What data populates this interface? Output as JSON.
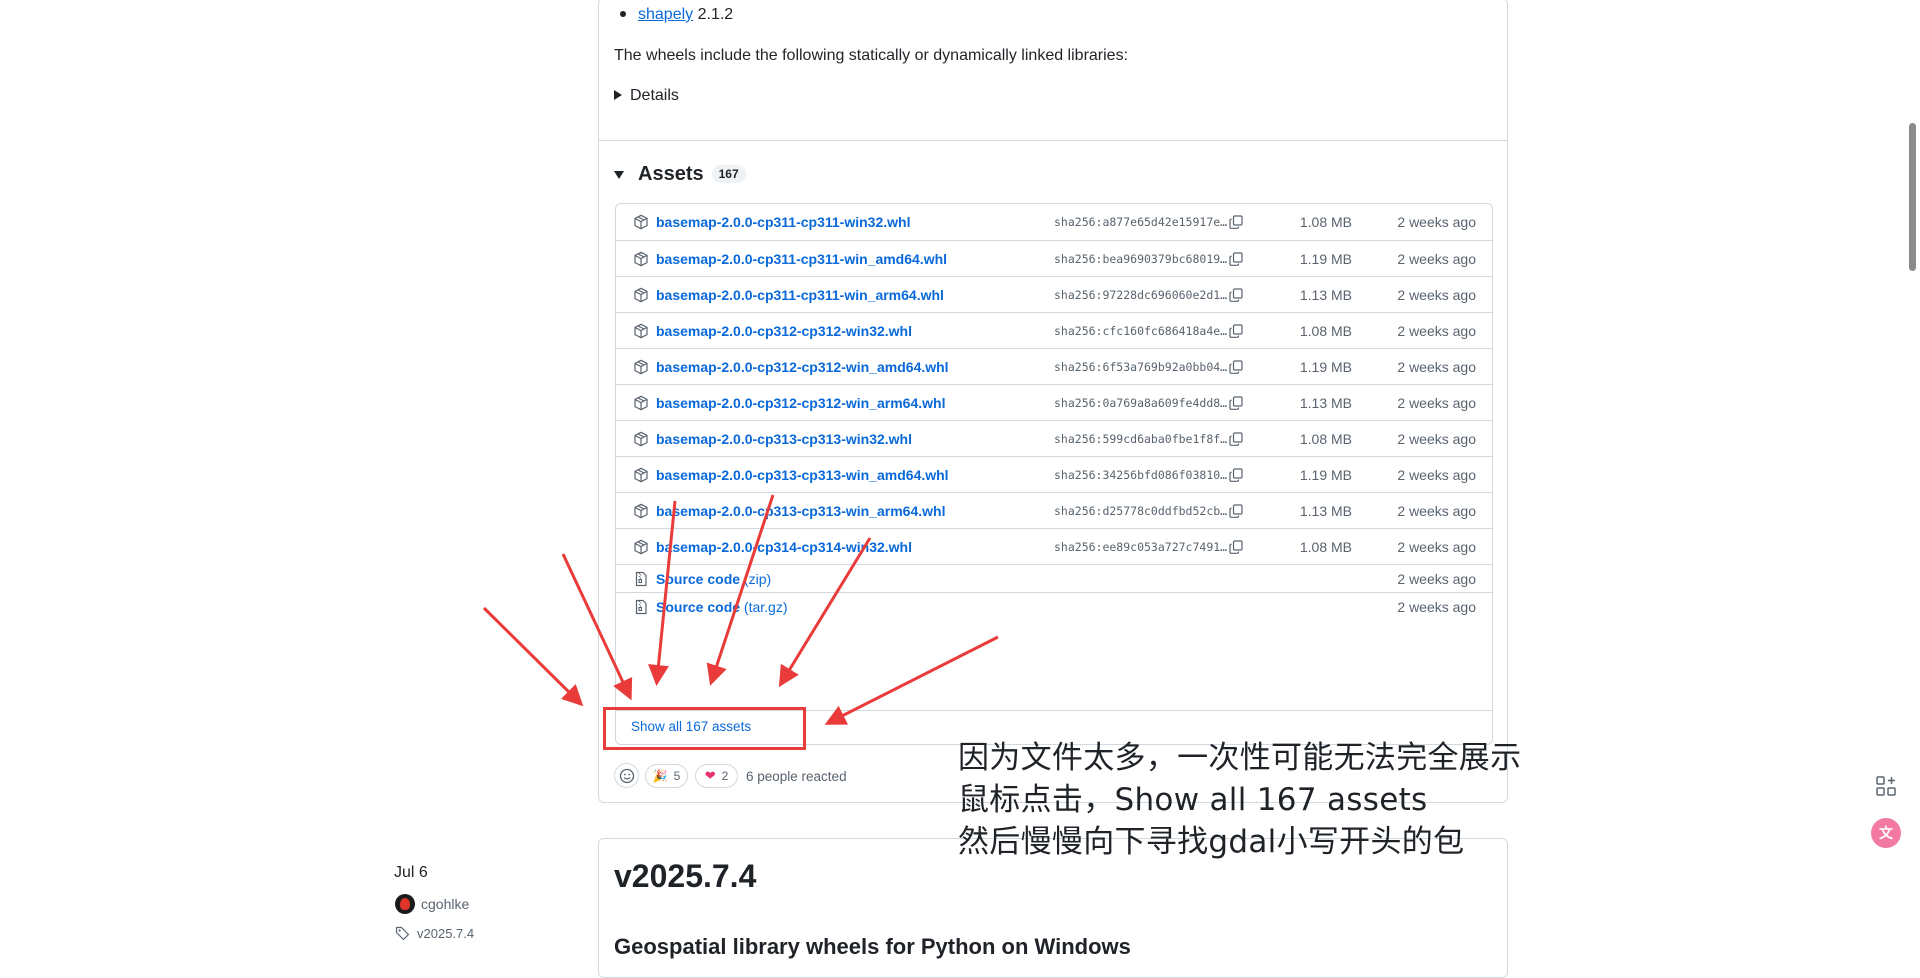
{
  "top": {
    "bullet_link": "shapely",
    "bullet_version": " 2.1.2",
    "libraries_text": "The wheels include the following statically or dynamically linked libraries:",
    "details_label": "Details"
  },
  "assets": {
    "heading": "Assets",
    "count": "167",
    "rows": [
      {
        "name": "basemap-2.0.0-cp311-cp311-win32.whl",
        "sha": "sha256:a877e65d42e15917e…",
        "size": "1.08 MB",
        "date": "2 weeks ago"
      },
      {
        "name": "basemap-2.0.0-cp311-cp311-win_amd64.whl",
        "sha": "sha256:bea9690379bc68019…",
        "size": "1.19 MB",
        "date": "2 weeks ago"
      },
      {
        "name": "basemap-2.0.0-cp311-cp311-win_arm64.whl",
        "sha": "sha256:97228dc696060e2d1…",
        "size": "1.13 MB",
        "date": "2 weeks ago"
      },
      {
        "name": "basemap-2.0.0-cp312-cp312-win32.whl",
        "sha": "sha256:cfc160fc686418a4e…",
        "size": "1.08 MB",
        "date": "2 weeks ago"
      },
      {
        "name": "basemap-2.0.0-cp312-cp312-win_amd64.whl",
        "sha": "sha256:6f53a769b92a0bb04…",
        "size": "1.19 MB",
        "date": "2 weeks ago"
      },
      {
        "name": "basemap-2.0.0-cp312-cp312-win_arm64.whl",
        "sha": "sha256:0a769a8a609fe4dd8…",
        "size": "1.13 MB",
        "date": "2 weeks ago"
      },
      {
        "name": "basemap-2.0.0-cp313-cp313-win32.whl",
        "sha": "sha256:599cd6aba0fbe1f8f…",
        "size": "1.08 MB",
        "date": "2 weeks ago"
      },
      {
        "name": "basemap-2.0.0-cp313-cp313-win_amd64.whl",
        "sha": "sha256:34256bfd086f03810…",
        "size": "1.19 MB",
        "date": "2 weeks ago"
      },
      {
        "name": "basemap-2.0.0-cp313-cp313-win_arm64.whl",
        "sha": "sha256:d25778c0ddfbd52cb…",
        "size": "1.13 MB",
        "date": "2 weeks ago"
      },
      {
        "name": "basemap-2.0.0-cp314-cp314-win32.whl",
        "sha": "sha256:ee89c053a727c7491…",
        "size": "1.08 MB",
        "date": "2 weeks ago"
      }
    ],
    "source_rows": [
      {
        "name": "Source code",
        "suffix": "(zip)",
        "date": "2 weeks ago"
      },
      {
        "name": "Source code",
        "suffix": "(tar.gz)",
        "date": "2 weeks ago"
      }
    ],
    "show_all": "Show all 167 assets"
  },
  "reactions": {
    "party_count": "5",
    "heart_count": "2",
    "summary": "6 people reacted"
  },
  "next_release": {
    "date": "Jul 6",
    "author": "cgohlke",
    "tag": "v2025.7.4",
    "title": "v2025.7.4",
    "subtitle": "Geospatial library wheels for Python on Windows"
  },
  "annotation": {
    "line1": "因为文件太多，一次性可能无法完全展示",
    "line2": "鼠标点击，Show all 167 assets",
    "line3": "然后慢慢向下寻找gdal小写开头的包",
    "color": "#ea3b3b"
  },
  "icons": {
    "asset": "package-icon",
    "source": "file-zip-icon",
    "copy": "copy-icon",
    "tag": "tag-icon",
    "smiley": "smiley-icon"
  }
}
